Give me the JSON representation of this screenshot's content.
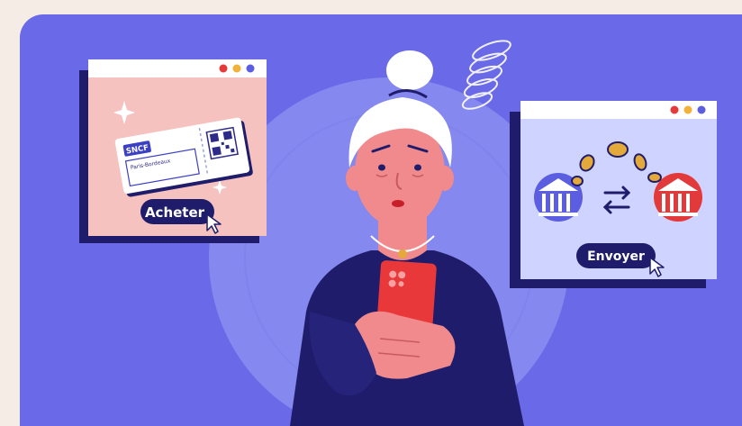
{
  "ticket_window": {
    "brand": "SNCF",
    "route": "Paris-Bordeaux",
    "action_label": "Acheter"
  },
  "transfer_window": {
    "action_label": "Envoyer"
  },
  "colors": {
    "background": "#6a6ae8",
    "navy": "#1f1d6b",
    "window_pink": "#f5c2c0",
    "window_lavender": "#cfd3ff",
    "phone_red": "#e8383a",
    "skin": "#f08a8c",
    "coin_gold": "#e3a93a"
  },
  "icons": [
    "sparkle-icon",
    "qr-code-icon",
    "bank-icon",
    "transfer-arrows-icon",
    "cursor-icon",
    "coin-icon",
    "confusion-swirl-icon"
  ]
}
